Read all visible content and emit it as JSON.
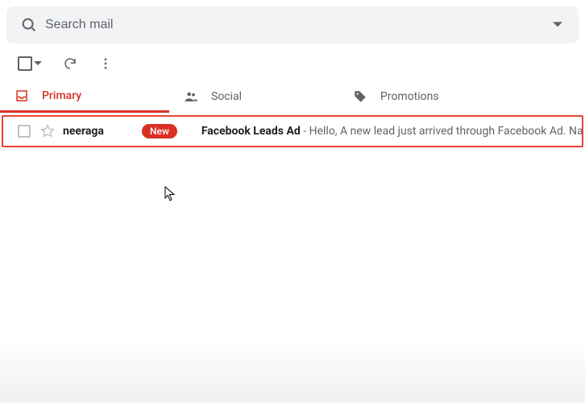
{
  "search": {
    "placeholder": "Search mail"
  },
  "tabs": {
    "primary": "Primary",
    "social": "Social",
    "promotions": "Promotions"
  },
  "email": {
    "sender": "neeraga",
    "badge": "New",
    "subject": "Facebook Leads Ad",
    "separator": " - ",
    "snippet": "Hello, A new lead just arrived through Facebook Ad. Name: Nave"
  }
}
